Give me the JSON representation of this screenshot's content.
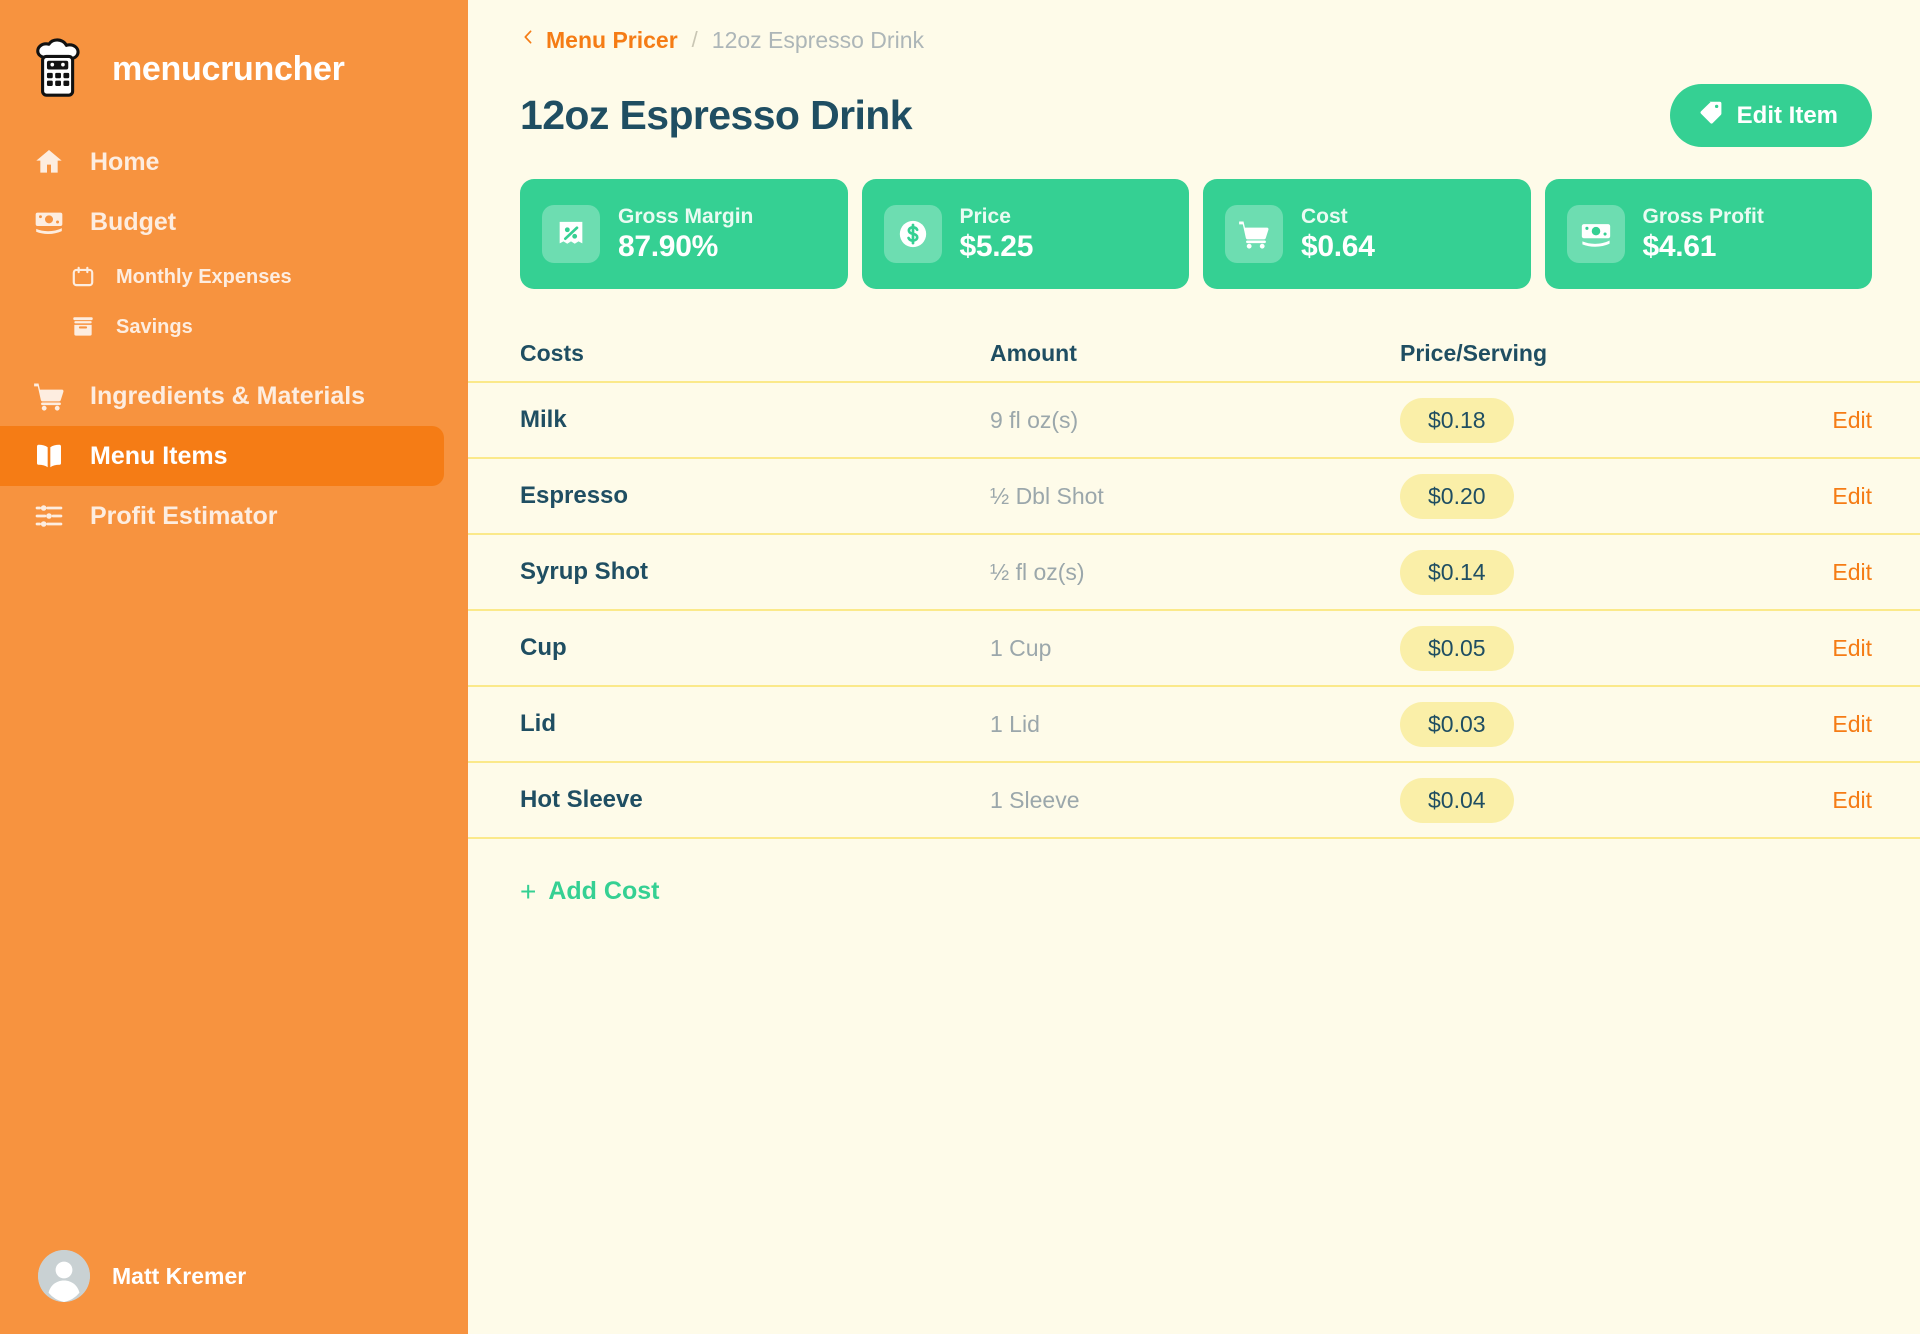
{
  "brand": {
    "name": "menucruncher",
    "logo_icon": "chef-calculator-logo"
  },
  "sidebar": {
    "items": [
      {
        "label": "Home",
        "icon": "home-icon",
        "level": "top",
        "active": false
      },
      {
        "label": "Budget",
        "icon": "money-bill-icon",
        "level": "top",
        "active": false
      },
      {
        "label": "Monthly Expenses",
        "icon": "calendar-icon",
        "level": "sub",
        "active": false
      },
      {
        "label": "Savings",
        "icon": "archive-box-icon",
        "level": "sub",
        "active": false
      },
      {
        "label": "Ingredients & Materials",
        "icon": "shopping-cart-icon",
        "level": "top",
        "active": false
      },
      {
        "label": "Menu Items",
        "icon": "open-book-icon",
        "level": "top",
        "active": true
      },
      {
        "label": "Profit Estimator",
        "icon": "sliders-icon",
        "level": "top",
        "active": false
      }
    ],
    "user": {
      "name": "Matt Kremer",
      "avatar_icon": "user-avatar-icon"
    }
  },
  "breadcrumb": {
    "back_icon": "chevron-left-icon",
    "parent": "Menu Pricer",
    "separator": "/",
    "current": "12oz Espresso Drink"
  },
  "header": {
    "title": "12oz Espresso Drink",
    "edit_button": {
      "label": "Edit Item",
      "icon": "tag-icon"
    }
  },
  "stats": [
    {
      "label": "Gross Margin",
      "value": "87.90%",
      "icon": "percent-receipt-icon"
    },
    {
      "label": "Price",
      "value": "$5.25",
      "icon": "dollar-coin-icon"
    },
    {
      "label": "Cost",
      "value": "$0.64",
      "icon": "shopping-cart-icon"
    },
    {
      "label": "Gross Profit",
      "value": "$4.61",
      "icon": "money-bill-icon"
    }
  ],
  "table": {
    "headers": {
      "name": "Costs",
      "amount": "Amount",
      "price": "Price/Serving"
    },
    "rows": [
      {
        "name": "Milk",
        "amount": "9 fl oz(s)",
        "price": "$0.18",
        "action": "Edit"
      },
      {
        "name": "Espresso",
        "amount": "½ Dbl Shot",
        "price": "$0.20",
        "action": "Edit"
      },
      {
        "name": "Syrup Shot",
        "amount": "½ fl oz(s)",
        "price": "$0.14",
        "action": "Edit"
      },
      {
        "name": "Cup",
        "amount": "1 Cup",
        "price": "$0.05",
        "action": "Edit"
      },
      {
        "name": "Lid",
        "amount": "1 Lid",
        "price": "$0.03",
        "action": "Edit"
      },
      {
        "name": "Hot Sleeve",
        "amount": "1 Sleeve",
        "price": "$0.04",
        "action": "Edit"
      }
    ]
  },
  "add_cost": {
    "label": "Add Cost",
    "icon": "plus-icon",
    "plus": "+"
  },
  "colors": {
    "sidebar_orange": "#F7933F",
    "active_orange": "#F57C15",
    "accent_green": "#35D093",
    "background_cream": "#FEFBE9",
    "text_teal": "#1F4E62",
    "pill_yellow": "#FAEFA8",
    "divider_yellow": "#FBE98A"
  }
}
